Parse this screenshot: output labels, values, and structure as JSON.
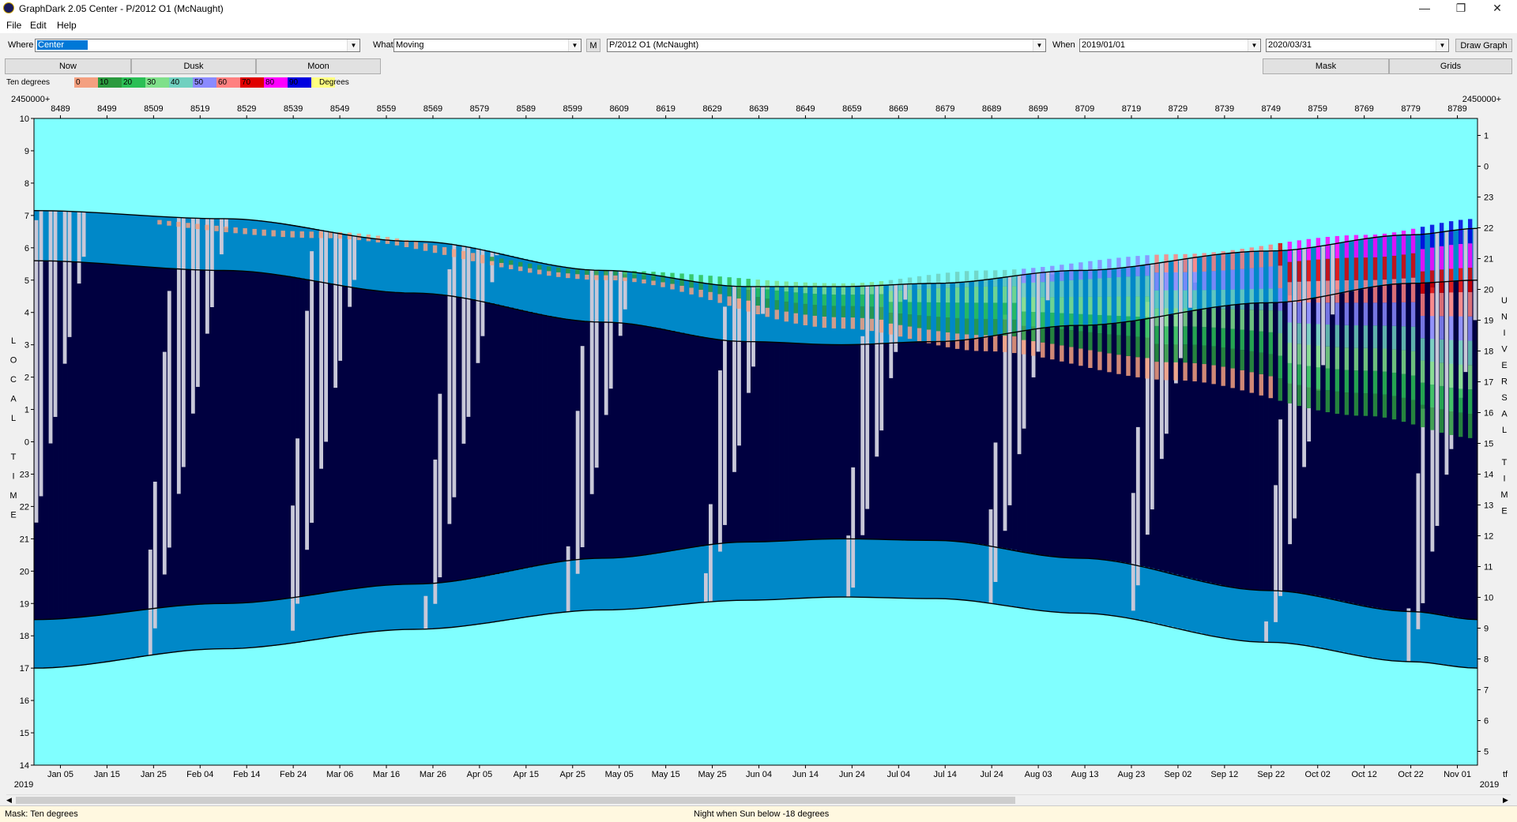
{
  "window": {
    "title": "GraphDark 2.05  Center  -  P/2012 O1 (McNaught)",
    "controls": {
      "minimize": "—",
      "restore": "❐",
      "close": "✕"
    }
  },
  "menu": [
    "File",
    "Edit",
    "Help"
  ],
  "toolbar": {
    "where_label": "Where",
    "where_value": "Center",
    "what_label": "What",
    "what_value": "Moving",
    "m_button": "M",
    "object_value": "P/2012 O1 (McNaught)",
    "when_label": "When",
    "start_date": "2019/01/01",
    "end_date": "2020/03/31",
    "draw_button": "Draw Graph"
  },
  "tabs_left": [
    "Now",
    "Dusk",
    "Moon"
  ],
  "tabs_right": [
    "Mask",
    "Grids"
  ],
  "legend": {
    "label": "Ten degrees",
    "units": "Degrees",
    "steps": [
      {
        "text": "0",
        "color": "#f4a080"
      },
      {
        "text": "10",
        "color": "#2b9a3e"
      },
      {
        "text": "20",
        "color": "#2bbf55"
      },
      {
        "text": "30",
        "color": "#7fe08a"
      },
      {
        "text": "40",
        "color": "#70d0c0"
      },
      {
        "text": "50",
        "color": "#8a8aff"
      },
      {
        "text": "60",
        "color": "#ff8080"
      },
      {
        "text": "70",
        "color": "#e00000"
      },
      {
        "text": "80",
        "color": "#ff00ff"
      },
      {
        "text": "90",
        "color": "#0000e0"
      },
      {
        "text": "",
        "color": "#ffff80"
      }
    ]
  },
  "colors": {
    "daylight": "#80ffff",
    "twilight": "#0088c8",
    "night": "#000040",
    "moon": "#c8c8d8"
  },
  "chart_data": {
    "type": "heatmap",
    "jd_prefix_left": "2450000+",
    "jd_prefix_right": "2450000+",
    "jd_ticks": [
      "8489",
      "8499",
      "8509",
      "8519",
      "8529",
      "8539",
      "8549",
      "8559",
      "8569",
      "8579",
      "8589",
      "8599",
      "8609",
      "8619",
      "8629",
      "8639",
      "8649",
      "8659",
      "8669",
      "8679",
      "8689",
      "8699",
      "8709",
      "8719",
      "8729",
      "8739",
      "8749",
      "8759",
      "8769",
      "8779",
      "8789"
    ],
    "date_ticks": [
      "Jan 05",
      "Jan 15",
      "Jan 25",
      "Feb 04",
      "Feb 14",
      "Feb 24",
      "Mar 06",
      "Mar 16",
      "Mar 26",
      "Apr 05",
      "Apr 15",
      "Apr 25",
      "May 05",
      "May 15",
      "May 25",
      "Jun 04",
      "Jun 14",
      "Jun 24",
      "Jul 04",
      "Jul 14",
      "Jul 24",
      "Aug 03",
      "Aug 13",
      "Aug 23",
      "Sep 02",
      "Sep 12",
      "Sep 22",
      "Oct 02",
      "Oct 12",
      "Oct 22",
      "Nov 01"
    ],
    "year_left": "2019",
    "year_right": "2019",
    "left_axis_title": "LOCAL TIME",
    "right_axis_title": "UNIVERSAL TIME",
    "right_corner_glyph": "tf",
    "left_ticks": [
      "10",
      "9",
      "8",
      "7",
      "6",
      "5",
      "4",
      "3",
      "2",
      "1",
      "0",
      "23",
      "22",
      "21",
      "20",
      "19",
      "18",
      "17",
      "16",
      "15",
      "14"
    ],
    "right_ticks": [
      "1",
      "0",
      "23",
      "22",
      "21",
      "20",
      "19",
      "18",
      "17",
      "16",
      "15",
      "14",
      "13",
      "12",
      "11",
      "10",
      "9",
      "8",
      "7",
      "6",
      "5"
    ],
    "ylim_local_hours": [
      14,
      34
    ],
    "days": 304,
    "sunset_local": [
      [
        0,
        17.0
      ],
      [
        40,
        17.6
      ],
      [
        80,
        18.2
      ],
      [
        120,
        18.8
      ],
      [
        150,
        19.1
      ],
      [
        170,
        19.2
      ],
      [
        190,
        19.15
      ],
      [
        220,
        18.7
      ],
      [
        260,
        17.8
      ],
      [
        290,
        17.2
      ],
      [
        304,
        17.0
      ]
    ],
    "dusk_local": [
      [
        0,
        18.5
      ],
      [
        40,
        19.0
      ],
      [
        80,
        19.6
      ],
      [
        120,
        20.4
      ],
      [
        150,
        20.9
      ],
      [
        170,
        21.0
      ],
      [
        190,
        20.95
      ],
      [
        220,
        20.4
      ],
      [
        260,
        19.4
      ],
      [
        290,
        18.75
      ],
      [
        304,
        18.5
      ]
    ],
    "dawn_local": [
      [
        0,
        29.6
      ],
      [
        40,
        29.3
      ],
      [
        80,
        28.6
      ],
      [
        120,
        27.7
      ],
      [
        150,
        27.1
      ],
      [
        170,
        27.0
      ],
      [
        190,
        27.1
      ],
      [
        220,
        27.6
      ],
      [
        260,
        28.3
      ],
      [
        290,
        28.9
      ],
      [
        304,
        29.0
      ]
    ],
    "sunrise_local": [
      [
        0,
        31.15
      ],
      [
        40,
        30.9
      ],
      [
        80,
        30.2
      ],
      [
        120,
        29.3
      ],
      [
        150,
        28.8
      ],
      [
        170,
        28.8
      ],
      [
        190,
        28.9
      ],
      [
        220,
        29.3
      ],
      [
        260,
        29.9
      ],
      [
        290,
        30.4
      ],
      [
        304,
        30.6
      ]
    ]
  },
  "status": {
    "mask": "Mask:  Ten degrees",
    "night": "Night when Sun below -18 degrees"
  }
}
